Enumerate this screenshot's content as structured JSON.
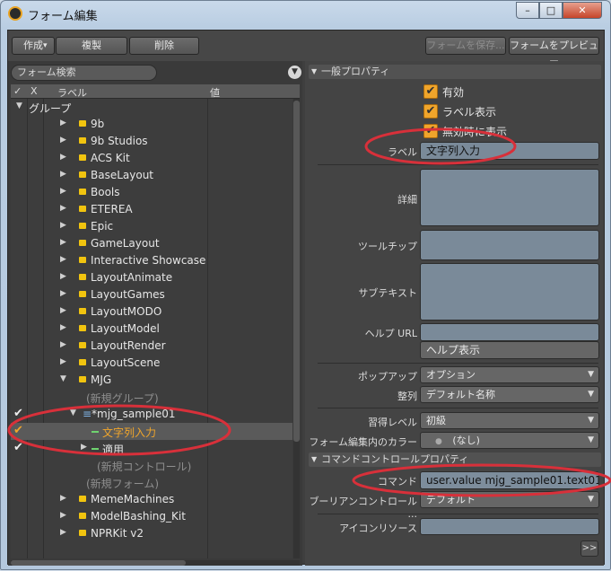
{
  "window": {
    "title": "フォーム編集",
    "min": "–",
    "max": "□",
    "close": "✕"
  },
  "toolbar": {
    "create": "作成",
    "create_caret": "▾",
    "duplicate": "複製",
    "delete": "削除",
    "save_form": "フォームを保存...",
    "preview": "フォームをプレビュー"
  },
  "left": {
    "search_placeholder": "フォーム検索",
    "filter_icon": "funnel-icon",
    "columns": {
      "check": "✓",
      "x": "X",
      "label": "ラベル",
      "value": "値"
    },
    "group_label": "グループ",
    "folders": [
      "9b",
      "9b Studios",
      "ACS Kit",
      "BaseLayout",
      "Bools",
      "ETEREA",
      "Epic",
      "GameLayout",
      "Interactive Showcase",
      "LayoutAnimate",
      "LayoutGames",
      "LayoutMODO",
      "LayoutModel",
      "LayoutRender",
      "LayoutScene"
    ],
    "mjg": "MJG",
    "new_group": "(新規グループ)",
    "sample": "*mjg_sample01",
    "text_input": "文字列入力",
    "apply": "適用",
    "new_control": "(新規コントロール)",
    "new_form": "(新規フォーム)",
    "after": [
      "MemeMachines",
      "ModelBashing_Kit",
      "NPRKit v2"
    ]
  },
  "right": {
    "general_section": "一般プロパティ",
    "enabled": "有効",
    "label_visible": "ラベル表示",
    "show_when_disabled": "無効時に表示",
    "label_label": "ラベル",
    "label_value": "文字列入力",
    "detail_label": "詳細",
    "tooltip_label": "ツールチップ",
    "subtext_label": "サブテキスト",
    "help_url_label": "ヘルプ URL",
    "help_display": "ヘルプ表示",
    "popup_label": "ポップアップ",
    "popup_value": "オプション",
    "sort_label": "整列",
    "sort_value": "デフォルト名称",
    "level_label": "習得レベル",
    "level_value": "初級",
    "color_label": "フォーム編集内のカラー",
    "color_value": "(なし)",
    "command_section": "コマンドコントロールプロパティ",
    "command_label": "コマンド",
    "command_value": "user.value mjg_sample01.text01 ?",
    "boolean_label": "ブーリアンコントロール ...",
    "boolean_value": "デフォルト",
    "icon_label": "アイコンリソース",
    "more": ">>"
  },
  "colors": {
    "accent": "#f0a52b",
    "annotation": "#d8303a"
  }
}
